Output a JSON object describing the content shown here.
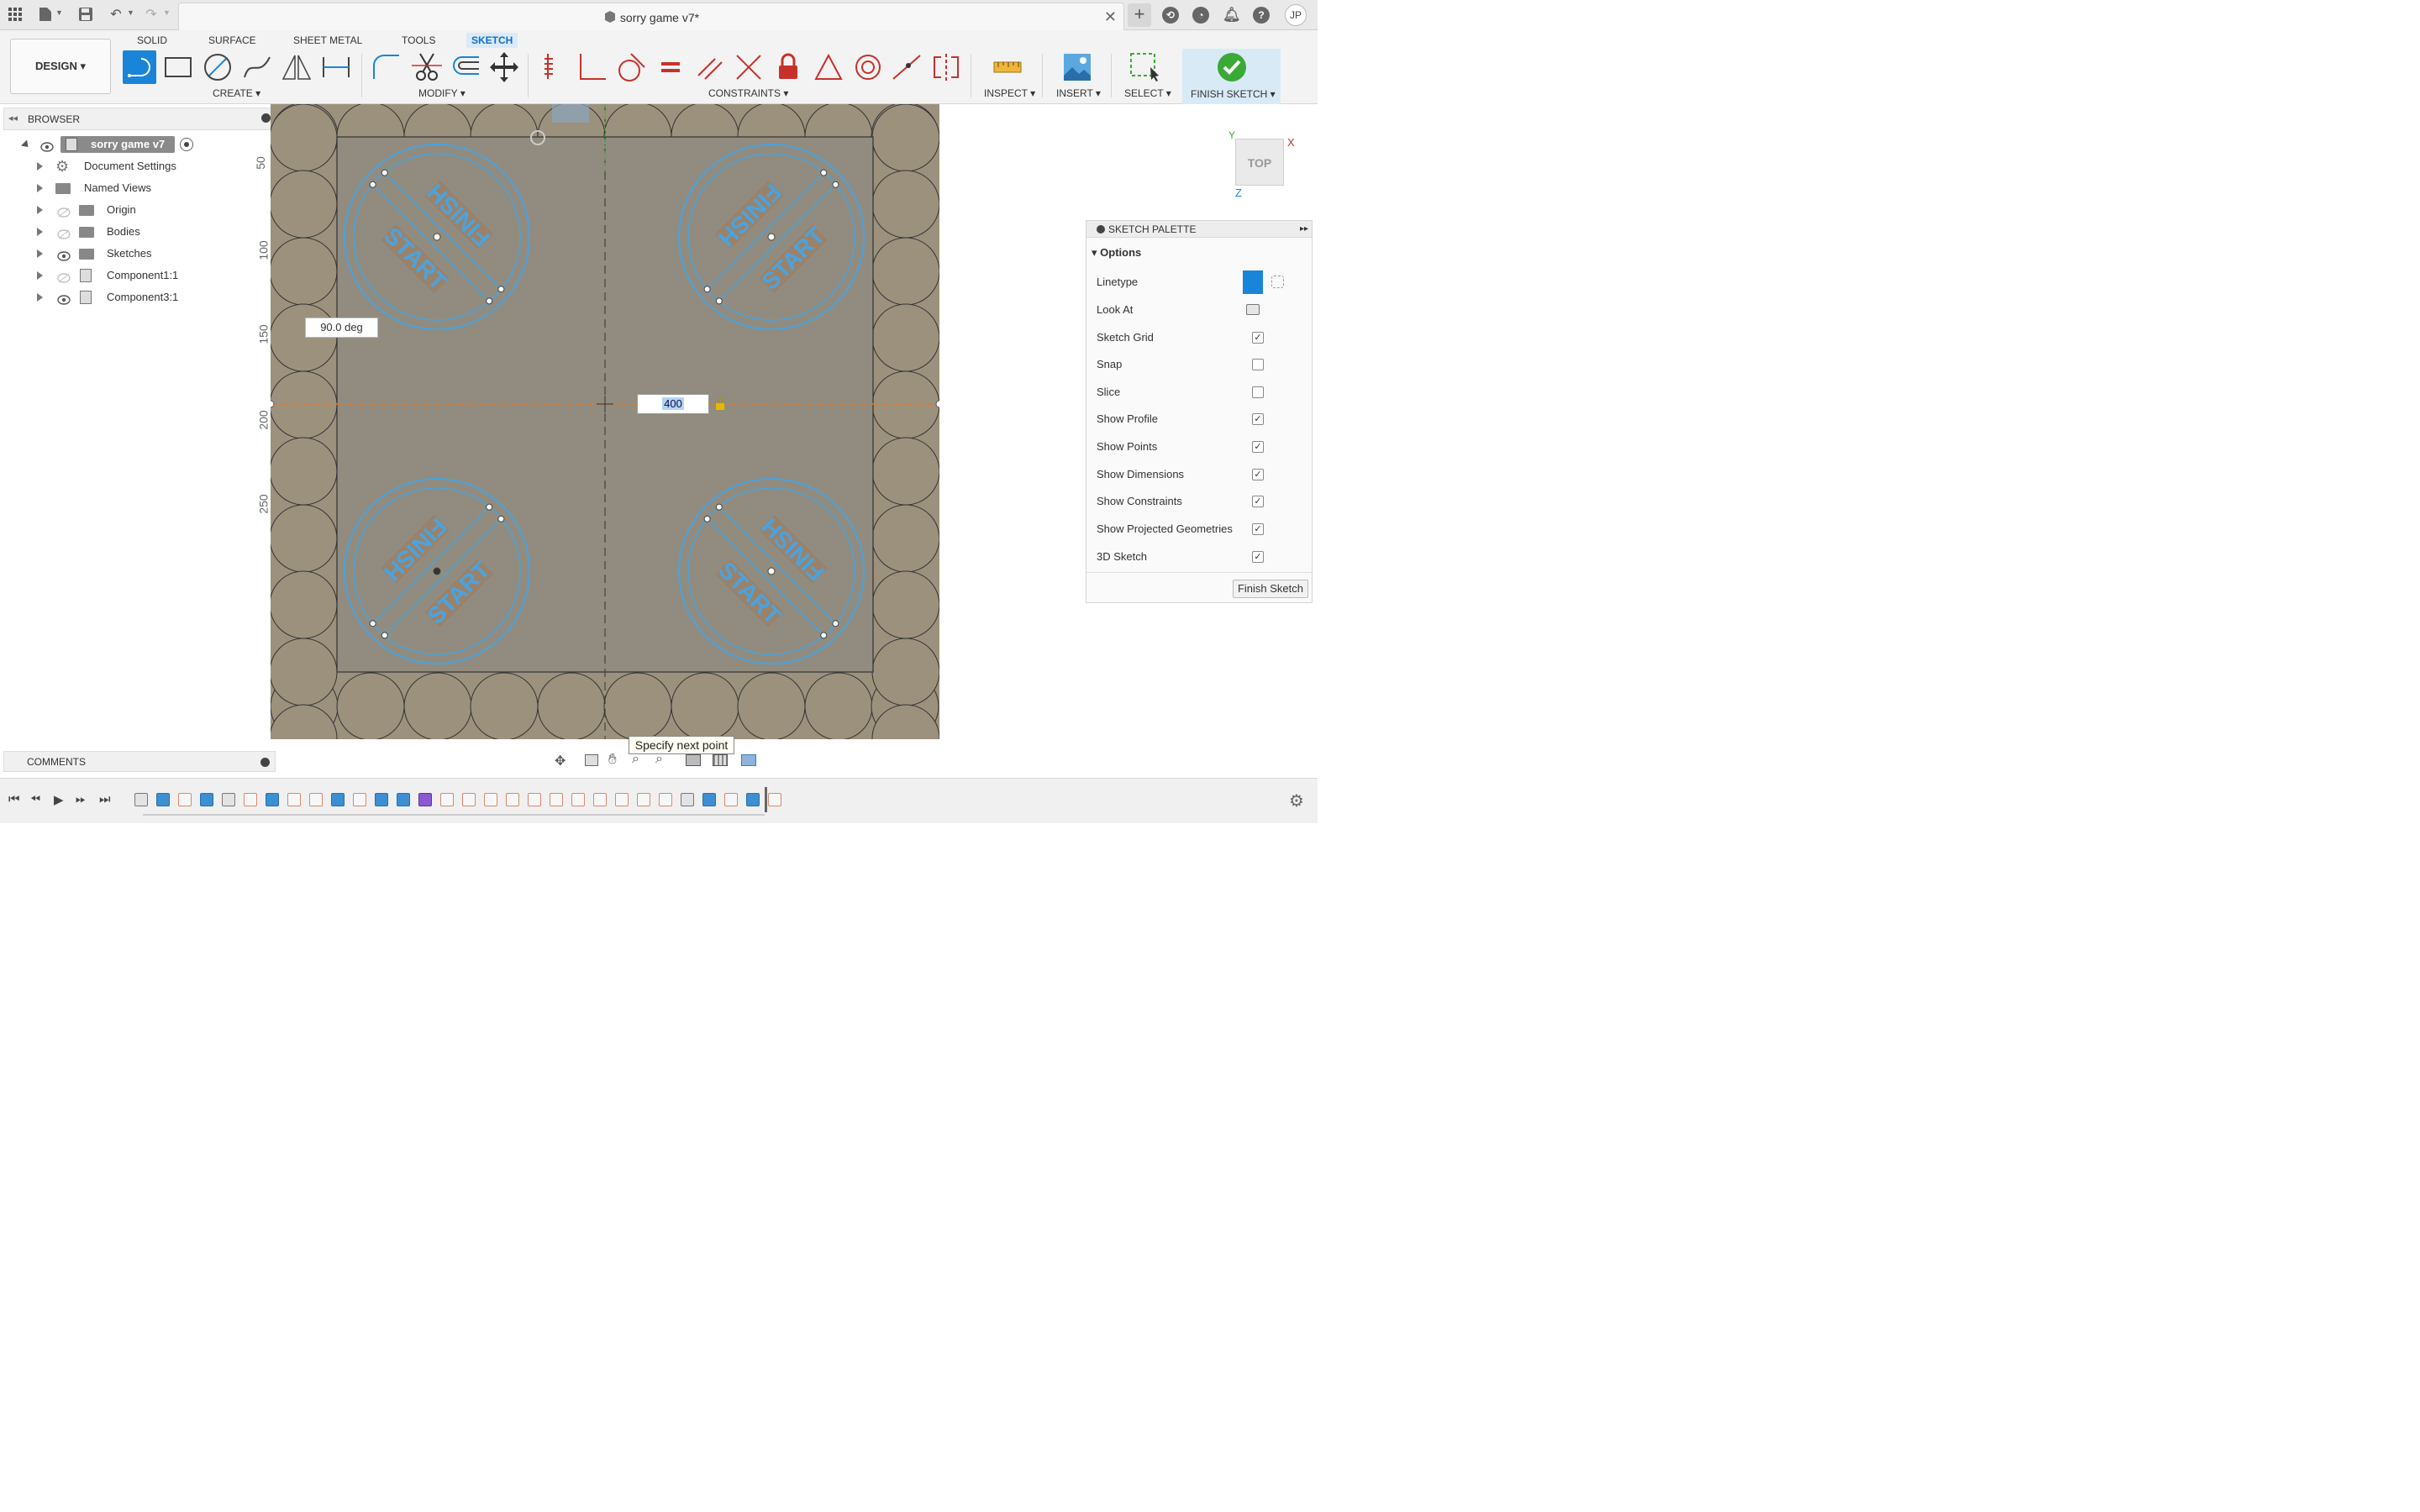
{
  "window": {
    "title": "sorry game v7*",
    "avatar_initials": "JP"
  },
  "workspace": {
    "design_label": "DESIGN"
  },
  "ribbon_tabs": [
    {
      "label": "SOLID",
      "active": false
    },
    {
      "label": "SURFACE",
      "active": false
    },
    {
      "label": "SHEET METAL",
      "active": false
    },
    {
      "label": "TOOLS",
      "active": false
    },
    {
      "label": "SKETCH",
      "active": true
    }
  ],
  "groups": {
    "create": "CREATE",
    "modify": "MODIFY",
    "constraints": "CONSTRAINTS",
    "inspect": "INSPECT",
    "insert": "INSERT",
    "select": "SELECT",
    "finish": "FINISH SKETCH"
  },
  "browser": {
    "title": "BROWSER",
    "root": "sorry game v7",
    "items": [
      {
        "label": "Document Settings",
        "icon": "gear-icon"
      },
      {
        "label": "Named Views",
        "icon": "folder-icon"
      },
      {
        "label": "Origin",
        "icon": "folder-icon"
      },
      {
        "label": "Bodies",
        "icon": "folder-icon"
      },
      {
        "label": "Sketches",
        "icon": "folder-icon"
      },
      {
        "label": "Component1:1",
        "icon": "component-icon"
      },
      {
        "label": "Component3:1",
        "icon": "component-icon"
      }
    ]
  },
  "comments": {
    "title": "COMMENTS"
  },
  "viewcube": {
    "face": "TOP",
    "axis_x": "X",
    "axis_y": "Y",
    "axis_z": "Z"
  },
  "canvas": {
    "ruler_ticks": [
      "50",
      "100",
      "150",
      "200",
      "250"
    ],
    "angle_label": "90.0 deg",
    "dimension_value": "400",
    "tooltip": "Specify next point",
    "text_start": "START",
    "text_finish": "FINISH"
  },
  "palette": {
    "title": "SKETCH PALETTE",
    "section": "Options",
    "options": [
      {
        "label": "Linetype",
        "type": "linetype"
      },
      {
        "label": "Look At",
        "type": "button"
      },
      {
        "label": "Sketch Grid",
        "checked": true
      },
      {
        "label": "Snap",
        "checked": false
      },
      {
        "label": "Slice",
        "checked": false
      },
      {
        "label": "Show Profile",
        "checked": true
      },
      {
        "label": "Show Points",
        "checked": true
      },
      {
        "label": "Show Dimensions",
        "checked": true
      },
      {
        "label": "Show Constraints",
        "checked": true
      },
      {
        "label": "Show Projected Geometries",
        "checked": true
      },
      {
        "label": "3D Sketch",
        "checked": true
      }
    ],
    "finish_button": "Finish Sketch"
  },
  "colors": {
    "accent": "#0f6fc6",
    "sketch_blue": "#4aa3df",
    "constraint_red": "#c8312b",
    "finish_green": "#3aa935",
    "board": "#9c917d"
  }
}
